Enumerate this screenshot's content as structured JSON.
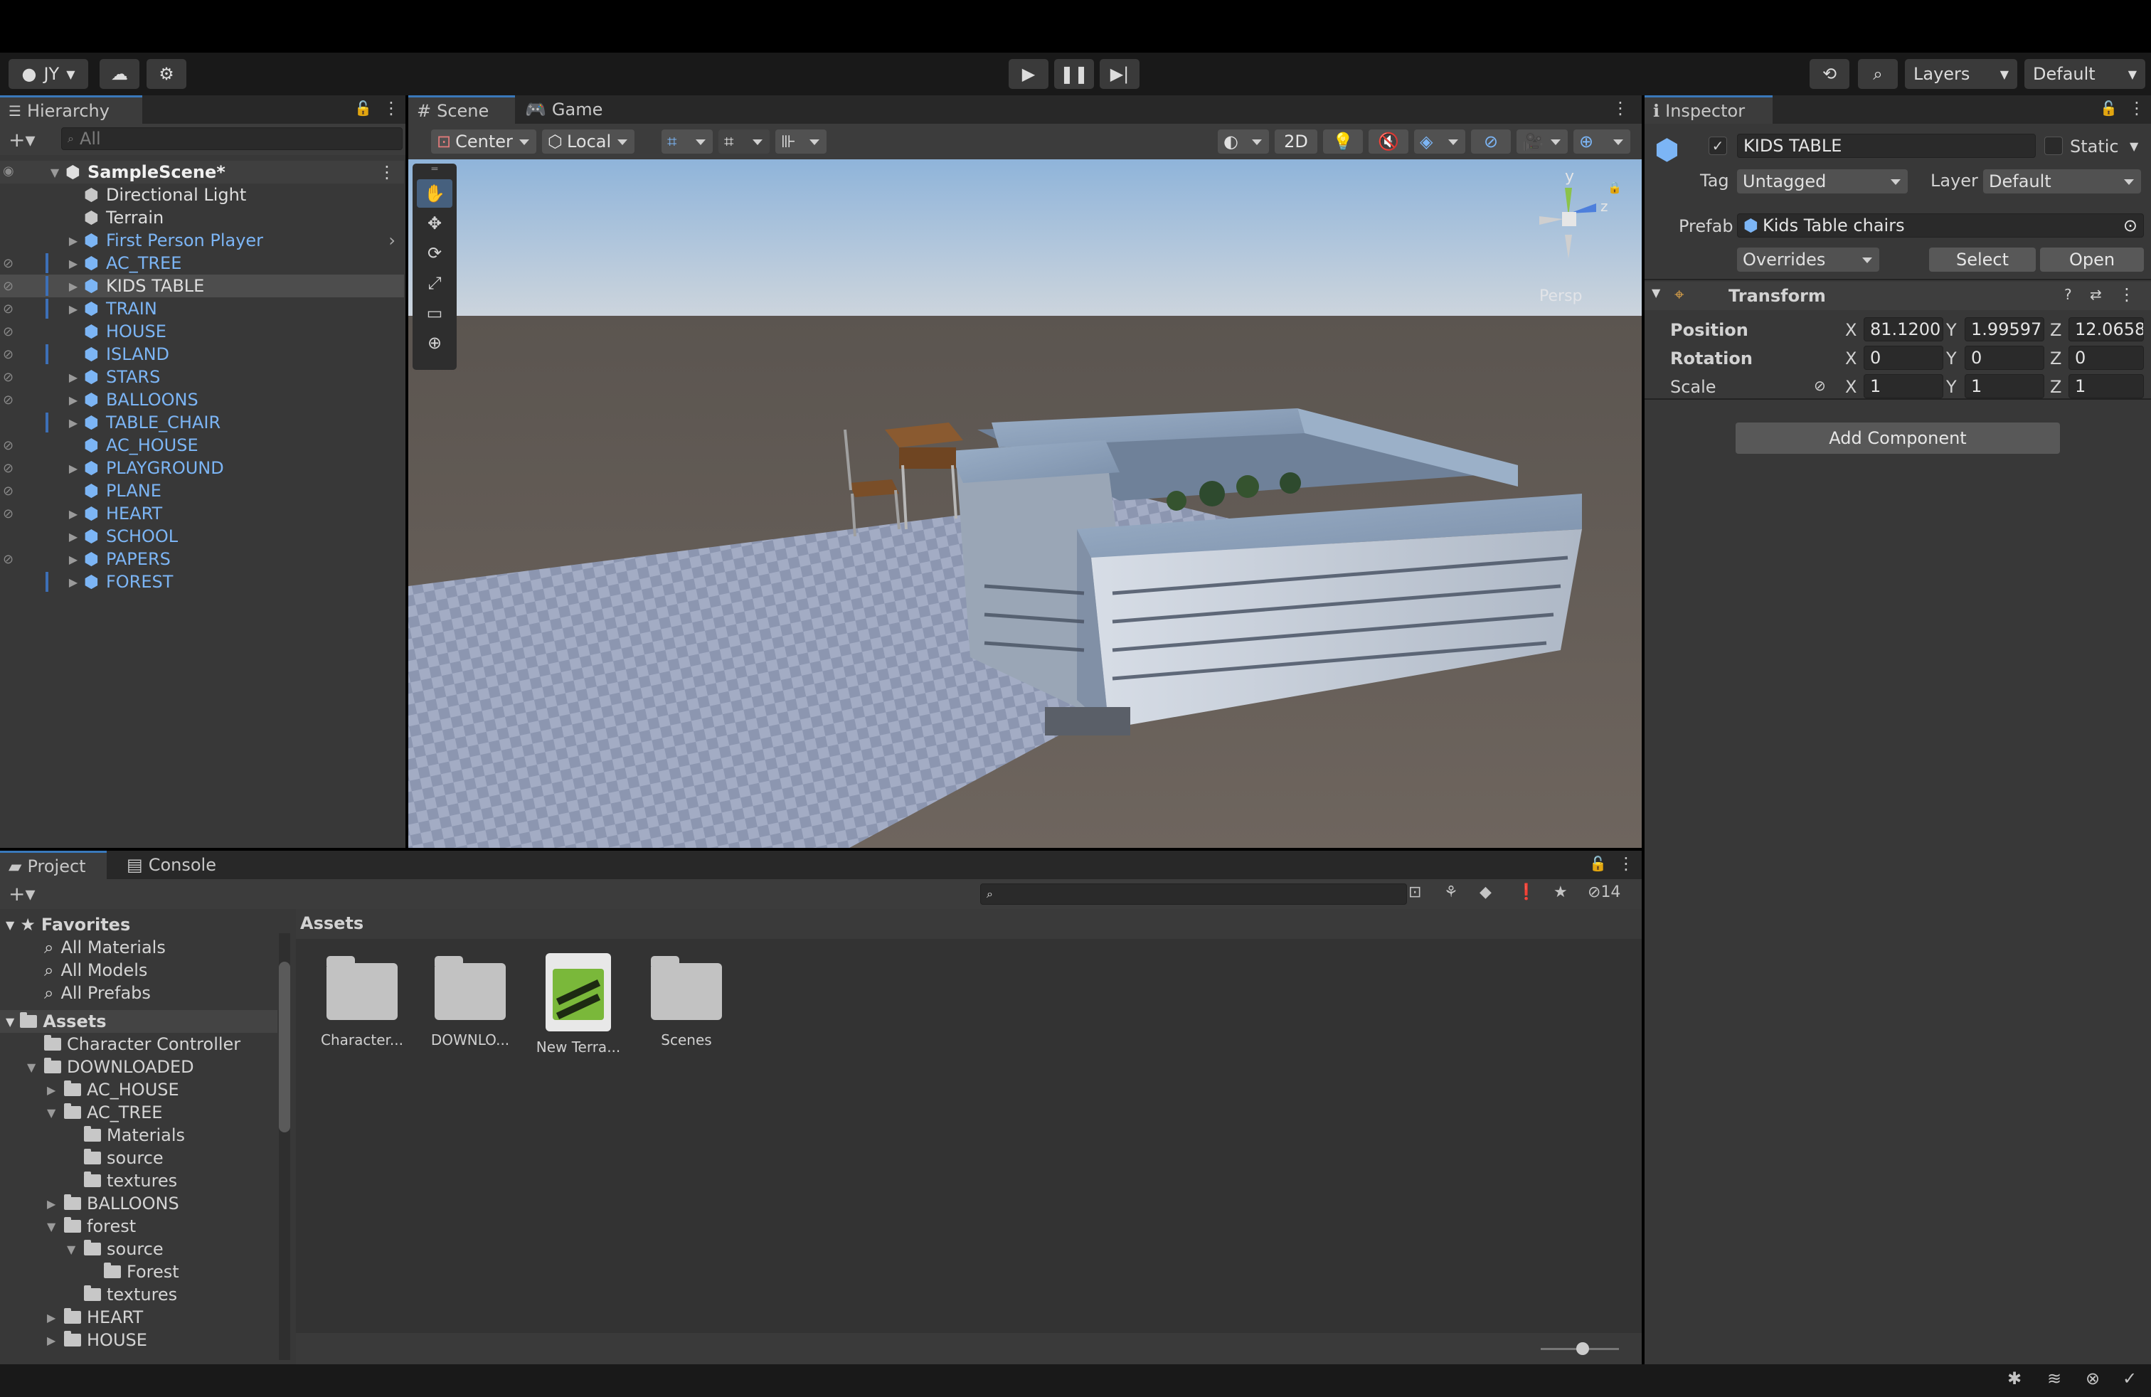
{
  "toolbar": {
    "account": "JY",
    "layers": "Layers",
    "layout": "Default"
  },
  "hierarchy": {
    "tab": "Hierarchy",
    "search_placeholder": "All",
    "scene": "SampleScene*",
    "items": [
      {
        "label": "Directional Light",
        "type": "object",
        "color": "white",
        "arrow": false
      },
      {
        "label": "Terrain",
        "type": "object",
        "color": "white",
        "arrow": false
      },
      {
        "label": "First Person Player",
        "type": "prefab",
        "color": "blue",
        "arrow": true
      },
      {
        "label": "AC_TREE",
        "type": "prefab",
        "color": "blue",
        "arrow": true
      },
      {
        "label": "KIDS TABLE",
        "type": "prefab",
        "color": "white",
        "arrow": true,
        "selected": true
      },
      {
        "label": "TRAIN",
        "type": "prefab",
        "color": "blue",
        "arrow": true
      },
      {
        "label": "HOUSE",
        "type": "prefab",
        "color": "blue",
        "arrow": false
      },
      {
        "label": "ISLAND",
        "type": "prefab",
        "color": "blue",
        "arrow": false
      },
      {
        "label": "STARS",
        "type": "prefab",
        "color": "blue",
        "arrow": true
      },
      {
        "label": "BALLOONS",
        "type": "prefab",
        "color": "blue",
        "arrow": true
      },
      {
        "label": "TABLE_CHAIR",
        "type": "prefab",
        "color": "blue",
        "arrow": true
      },
      {
        "label": "AC_HOUSE",
        "type": "prefab",
        "color": "blue",
        "arrow": false
      },
      {
        "label": "PLAYGROUND",
        "type": "prefab",
        "color": "blue",
        "arrow": true
      },
      {
        "label": "PLANE",
        "type": "prefab",
        "color": "blue",
        "arrow": false
      },
      {
        "label": "HEART",
        "type": "prefab",
        "color": "blue",
        "arrow": true
      },
      {
        "label": "SCHOOL",
        "type": "prefab",
        "color": "blue",
        "arrow": true
      },
      {
        "label": "PAPERS",
        "type": "prefab",
        "color": "blue",
        "arrow": true
      },
      {
        "label": "FOREST",
        "type": "prefab",
        "color": "blue",
        "arrow": true
      }
    ]
  },
  "scene_view": {
    "tab_scene": "Scene",
    "tab_game": "Game",
    "pivot": "Center",
    "space": "Local",
    "mode_2d": "2D",
    "persp": "Persp",
    "axis_y": "y",
    "axis_z": "z"
  },
  "inspector": {
    "tab": "Inspector",
    "name": "KIDS TABLE",
    "static_label": "Static",
    "tag_label": "Tag",
    "tag_value": "Untagged",
    "layer_label": "Layer",
    "layer_value": "Default",
    "prefab_label": "Prefab",
    "prefab_value": "Kids Table chairs",
    "overrides": "Overrides",
    "select": "Select",
    "open": "Open",
    "transform": "Transform",
    "position_label": "Position",
    "rotation_label": "Rotation",
    "scale_label": "Scale",
    "position": {
      "x": "81.1200",
      "y": "1.99597",
      "z": "12.0658"
    },
    "rotation": {
      "x": "0",
      "y": "0",
      "z": "0"
    },
    "scale": {
      "x": "1",
      "y": "1",
      "z": "1"
    },
    "axis_x": "X",
    "axis_y": "Y",
    "axis_z": "Z",
    "add_component": "Add Component"
  },
  "project": {
    "tab_project": "Project",
    "tab_console": "Console",
    "hidden_count": "14",
    "favorites": "Favorites",
    "fav_items": [
      "All Materials",
      "All Models",
      "All Prefabs"
    ],
    "assets_root": "Assets",
    "tree": [
      {
        "label": "Character Controller",
        "indent": 0,
        "arrow": ""
      },
      {
        "label": "DOWNLOADED",
        "indent": 0,
        "arrow": "▼"
      },
      {
        "label": "AC_HOUSE",
        "indent": 1,
        "arrow": "▶"
      },
      {
        "label": "AC_TREE",
        "indent": 1,
        "arrow": "▼"
      },
      {
        "label": "Materials",
        "indent": 2,
        "arrow": ""
      },
      {
        "label": "source",
        "indent": 2,
        "arrow": ""
      },
      {
        "label": "textures",
        "indent": 2,
        "arrow": ""
      },
      {
        "label": "BALLOONS",
        "indent": 1,
        "arrow": "▶"
      },
      {
        "label": "forest",
        "indent": 1,
        "arrow": "▼"
      },
      {
        "label": "source",
        "indent": 2,
        "arrow": "▼"
      },
      {
        "label": "Forest",
        "indent": 3,
        "arrow": ""
      },
      {
        "label": "textures",
        "indent": 2,
        "arrow": ""
      },
      {
        "label": "HEART",
        "indent": 1,
        "arrow": "▶"
      },
      {
        "label": "HOUSE",
        "indent": 1,
        "arrow": "▶"
      }
    ],
    "breadcrumb": "Assets",
    "assets": [
      {
        "label": "Character...",
        "kind": "folder"
      },
      {
        "label": "DOWNLO...",
        "kind": "folder"
      },
      {
        "label": "New Terra...",
        "kind": "terrain"
      },
      {
        "label": "Scenes",
        "kind": "folder"
      }
    ]
  },
  "colors": {
    "accent": "#3a79bb",
    "prefab_blue": "#7cb5f5",
    "panel": "#383838",
    "toolbar": "#191919"
  }
}
